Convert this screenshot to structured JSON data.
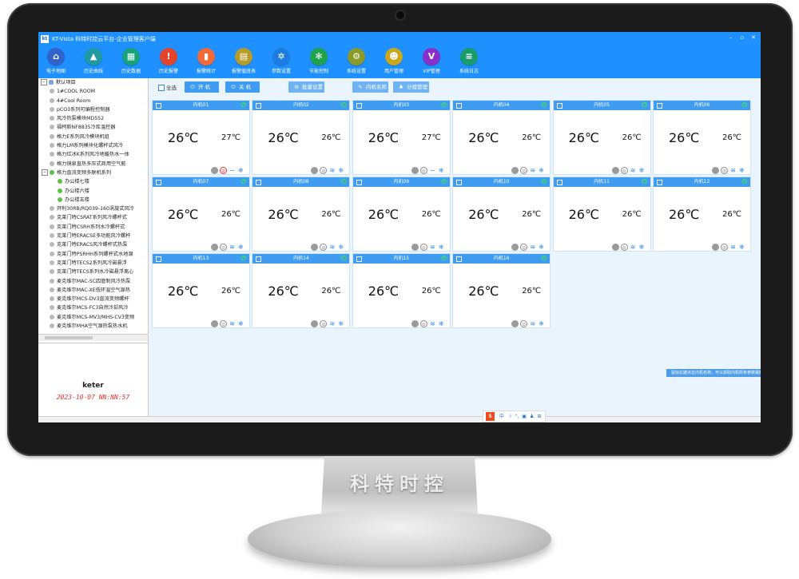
{
  "stand_logo": "科特时控",
  "window": {
    "logo_text": "kt",
    "title": "KT-Vista 科特时控云平台-企业管理客户端",
    "controls": [
      "–",
      "▫",
      "✕"
    ]
  },
  "toolbar": [
    {
      "label": "电子地图",
      "icon": "home-icon",
      "glyph": "⌂",
      "color": "#2f63c9"
    },
    {
      "label": "历史曲线",
      "icon": "chart-area-icon",
      "glyph": "▲",
      "color": "#1f9aa0"
    },
    {
      "label": "历史数据",
      "icon": "table-icon",
      "glyph": "▦",
      "color": "#17a27a"
    },
    {
      "label": "历史报警",
      "icon": "alert-icon",
      "glyph": "!",
      "color": "#e2452b"
    },
    {
      "label": "报警统计",
      "icon": "bar-chart-icon",
      "glyph": "▮",
      "color": "#f26a3a"
    },
    {
      "label": "报警值班表",
      "icon": "calendar-icon",
      "glyph": "▤",
      "color": "#b89c2a"
    },
    {
      "label": "参数设置",
      "icon": "gear-icon",
      "glyph": "✲",
      "color": "#1c7ce0"
    },
    {
      "label": "节能控制",
      "icon": "snowflake-icon",
      "glyph": "✻",
      "color": "#1ea34a"
    },
    {
      "label": "系统设置",
      "icon": "settings-icon",
      "glyph": "⚙",
      "color": "#8b9a2a"
    },
    {
      "label": "用户管理",
      "icon": "user-icon",
      "glyph": "☻",
      "color": "#c9a820"
    },
    {
      "label": "VIP管理",
      "icon": "vip-icon",
      "glyph": "V",
      "color": "#8a2fc9"
    },
    {
      "label": "系统日志",
      "icon": "log-icon",
      "glyph": "≡",
      "color": "#1a9b6a"
    }
  ],
  "tree": {
    "root": "默认项目",
    "items": [
      {
        "label": "1#COOL ROOM",
        "indent": 1,
        "state": "gray"
      },
      {
        "label": "4#Cool Room",
        "indent": 1,
        "state": "gray"
      },
      {
        "label": "pCO3系列可编程控制器",
        "indent": 1,
        "state": "gray"
      },
      {
        "label": "风冷热泵模块MD552",
        "indent": 1,
        "state": "gray"
      },
      {
        "label": "福柯斯NF8835冷库温控器",
        "indent": 1,
        "state": "gray"
      },
      {
        "label": "格力E系列风冷模块机组",
        "indent": 1,
        "state": "gray"
      },
      {
        "label": "格力LM系列模块化螺杆式风冷",
        "indent": 1,
        "state": "gray"
      },
      {
        "label": "格力红冰K系列风冷地暖热水一体",
        "indent": 1,
        "state": "gray"
      },
      {
        "label": "格力镜泉直热多压式商用空气能",
        "indent": 1,
        "state": "gray"
      },
      {
        "label": "格力直流变频多联机系列",
        "indent": 1,
        "state": "green",
        "expanded": true
      },
      {
        "label": "办公楼七楼",
        "indent": 2,
        "state": "green"
      },
      {
        "label": "办公楼六楼",
        "indent": 2,
        "state": "green"
      },
      {
        "label": "办公楼五楼",
        "indent": 2,
        "state": "green"
      },
      {
        "label": "开利30RB/RQ039-160涡旋式风冷",
        "indent": 1,
        "state": "gray"
      },
      {
        "label": "克莱门特CSRAT系列风冷螺杆式",
        "indent": 1,
        "state": "gray"
      },
      {
        "label": "克莱门特CSRH系列水冷螺杆式",
        "indent": 1,
        "state": "gray"
      },
      {
        "label": "克莱门特ERACSE多功能风冷螺杆",
        "indent": 1,
        "state": "gray"
      },
      {
        "label": "克莱门特ERACS风冷螺杆式热泵",
        "indent": 1,
        "state": "gray"
      },
      {
        "label": "克莱门特PSRHH系列螺杆式水地源",
        "indent": 1,
        "state": "gray"
      },
      {
        "label": "克莱门特TECS2系列风冷磁悬浮",
        "indent": 1,
        "state": "gray"
      },
      {
        "label": "克莱门特TECS系列水冷磁悬浮离心",
        "indent": 1,
        "state": "gray"
      },
      {
        "label": "麦克维尔MAC-SC四管制风冷热泵",
        "indent": 1,
        "state": "gray"
      },
      {
        "label": "麦克维尔MAC-XE低环温空气源热",
        "indent": 1,
        "state": "gray"
      },
      {
        "label": "麦克维尔MCS-DV3直流变频螺杆",
        "indent": 1,
        "state": "gray"
      },
      {
        "label": "麦克维尔MCS-FC3自然冷却风冷",
        "indent": 1,
        "state": "gray"
      },
      {
        "label": "麦克维尔MCS-MV3/MHS-CV3变频",
        "indent": 1,
        "state": "gray"
      },
      {
        "label": "麦克维尔MHA空气源热泵热水机",
        "indent": 1,
        "state": "gray"
      }
    ]
  },
  "user": {
    "name": "keter",
    "datetime": "2023-10-07 NN:NN:57"
  },
  "actions": {
    "select_all": "全选",
    "power_on": "开 机",
    "power_off": "关 机",
    "batch_settings": "批量设置",
    "rename_unit": "内机名称",
    "group_manage": "分组管理"
  },
  "hint": "鼠标右键点击内机名称，可以获取内机所有参数最新值",
  "units": [
    {
      "name": "内机01",
      "set_temp": "26℃",
      "room_temp": "27℃",
      "mode": "fan",
      "alarm": true
    },
    {
      "name": "内机02",
      "set_temp": "26℃",
      "room_temp": "26℃",
      "mode": "cool",
      "alarm": false
    },
    {
      "name": "内机03",
      "set_temp": "26℃",
      "room_temp": "27℃",
      "mode": "fan",
      "alarm": false
    },
    {
      "name": "内机04",
      "set_temp": "26℃",
      "room_temp": "26℃",
      "mode": "cool",
      "alarm": false
    },
    {
      "name": "内机05",
      "set_temp": "26℃",
      "room_temp": "26℃",
      "mode": "cool",
      "alarm": false
    },
    {
      "name": "内机06",
      "set_temp": "26℃",
      "room_temp": "26℃",
      "mode": "cool",
      "alarm": false
    },
    {
      "name": "内机07",
      "set_temp": "26℃",
      "room_temp": "26℃",
      "mode": "cool",
      "alarm": false
    },
    {
      "name": "内机08",
      "set_temp": "26℃",
      "room_temp": "26℃",
      "mode": "cool",
      "alarm": false
    },
    {
      "name": "内机09",
      "set_temp": "26℃",
      "room_temp": "26℃",
      "mode": "cool",
      "alarm": false
    },
    {
      "name": "内机10",
      "set_temp": "26℃",
      "room_temp": "26℃",
      "mode": "cool",
      "alarm": false
    },
    {
      "name": "内机11",
      "set_temp": "26℃",
      "room_temp": "26℃",
      "mode": "cool",
      "alarm": false
    },
    {
      "name": "内机12",
      "set_temp": "26℃",
      "room_temp": "26℃",
      "mode": "cool",
      "alarm": false
    },
    {
      "name": "内机13",
      "set_temp": "26℃",
      "room_temp": "26℃",
      "mode": "cool",
      "alarm": false
    },
    {
      "name": "内机14",
      "set_temp": "26℃",
      "room_temp": "26℃",
      "mode": "cool",
      "alarm": false
    },
    {
      "name": "内机15",
      "set_temp": "26℃",
      "room_temp": "26℃",
      "mode": "cool",
      "alarm": false
    },
    {
      "name": "内机16",
      "set_temp": "26℃",
      "room_temp": "26℃",
      "mode": "cool",
      "alarm": false
    }
  ],
  "ime": {
    "logo": "S",
    "items": [
      "中",
      "☽",
      "°,",
      "▣",
      "♟",
      "⊞"
    ]
  }
}
